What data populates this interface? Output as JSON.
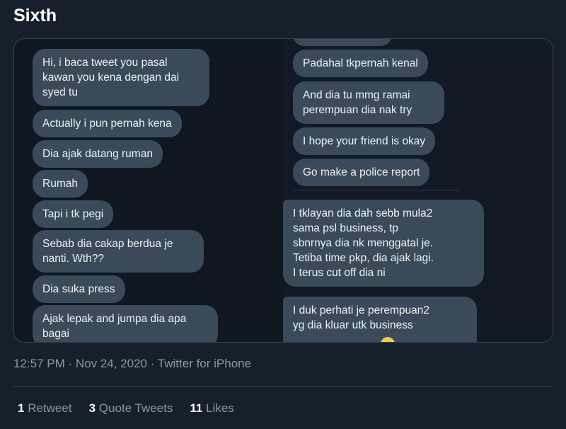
{
  "tweet": {
    "text": "Sixth",
    "timestamp": "12:57 PM · Nov 24, 2020 · Twitter for iPhone"
  },
  "stats": {
    "retweets_count": "1",
    "retweets_label": "Retweet",
    "quotes_count": "3",
    "quotes_label": "Quote Tweets",
    "likes_count": "11",
    "likes_label": "Likes"
  },
  "media": {
    "left_messages": [
      "Hi, i baca tweet you pasal\nkawan you kena dengan dai\nsyed tu",
      "Actually i pun pernah kena",
      "Dia ajak datang ruman",
      "Rumah",
      "Tapi i tk pegi",
      "Sebab dia cakap berdua je\nnanti. Wth??",
      "Dia suka press",
      "Ajak lepak and jumpa dia apa\nbagai"
    ],
    "right_messages": [
      "Padahal tkpernah kenal",
      "And dia tu mmg ramai\nperempuan dia nak try",
      "I hope your friend is okay",
      "Go make a police report",
      "I tklayan dia dah sebb mula2\nsama psl business, tp\nsbnrnya dia nk menggatal je.\nTetiba time pkp, dia ajak lagi.\nI terus cut off dia ni",
      "I duk perhati je perempuan2\nyg dia kluar utk business"
    ]
  }
}
